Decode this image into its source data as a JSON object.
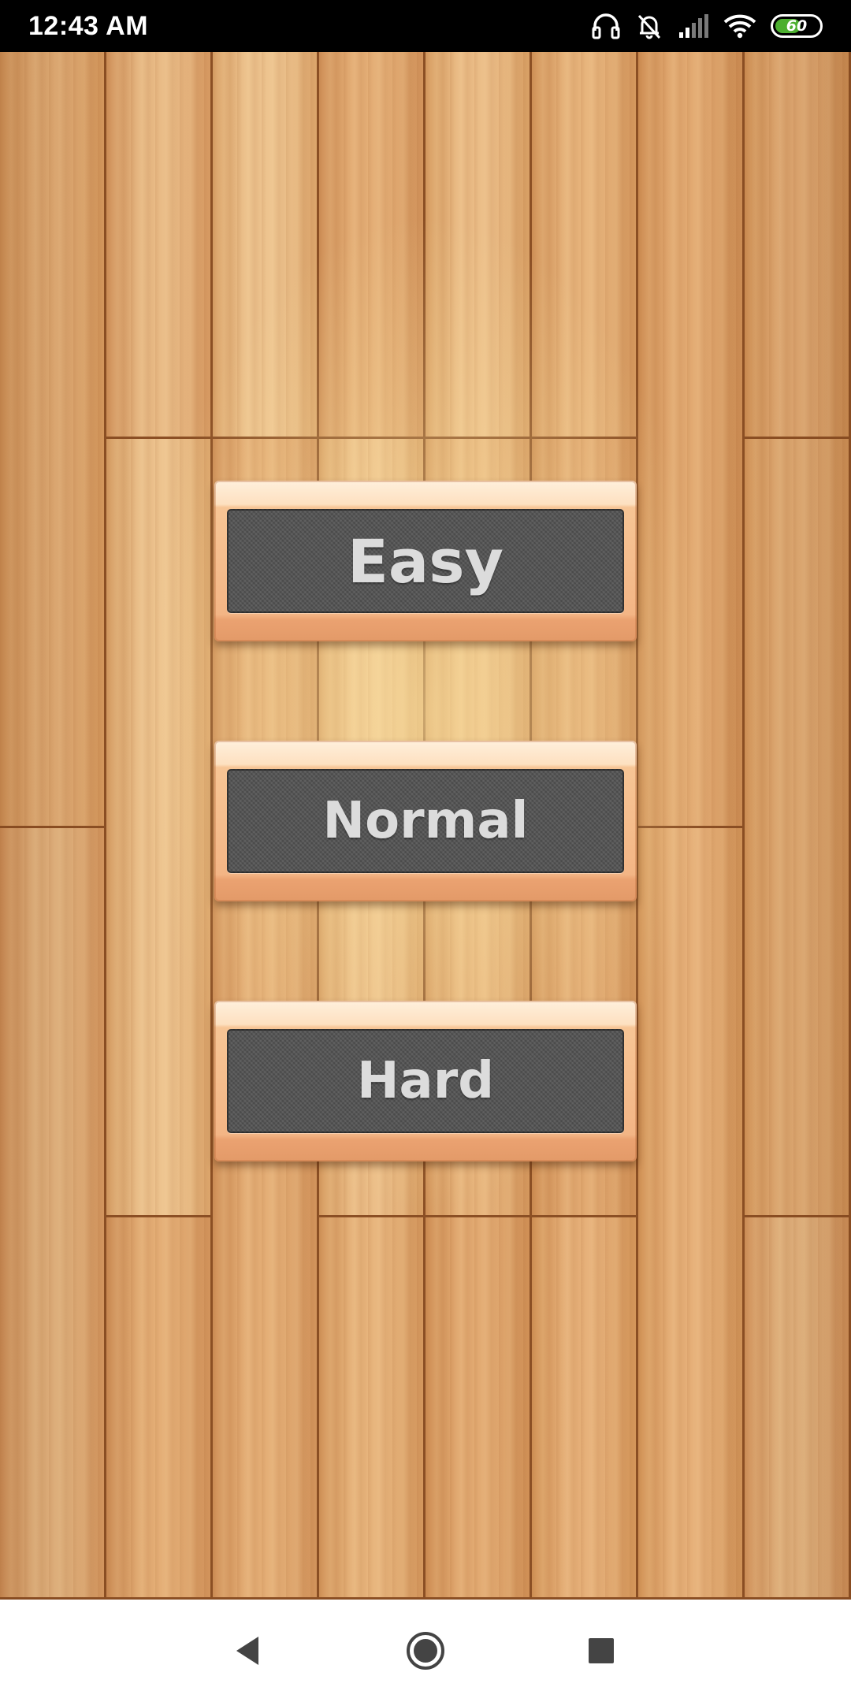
{
  "status_bar": {
    "time": "12:43 AM",
    "battery_level": "60",
    "icons": [
      "headset-icon",
      "bell-muted-icon",
      "signal-icon",
      "wifi-icon",
      "battery-icon"
    ],
    "battery_fill_fraction": 0.6,
    "battery_fill_color": "#4caf2f"
  },
  "menu": {
    "buttons": [
      {
        "label": "Easy"
      },
      {
        "label": "Normal"
      },
      {
        "label": "Hard"
      }
    ]
  },
  "navigation_bar": {
    "buttons": [
      "back-icon",
      "home-icon",
      "recents-icon"
    ]
  },
  "colors": {
    "wood_light": "#e8b77e",
    "wood_dark": "#8b4f24",
    "button_face": "#525252",
    "button_frame": "#f3b585",
    "label_text": "#dcdcdc"
  }
}
